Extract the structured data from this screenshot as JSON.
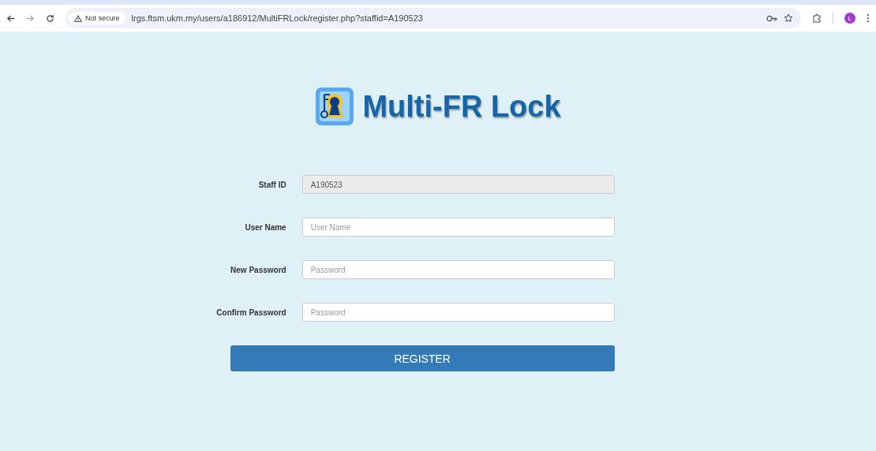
{
  "browser": {
    "security_label": "Not secure",
    "url": "lrgs.ftsm.ukm.my/users/a186912/MultiFRLock/register.php?staffid=A190523",
    "profile_initial": "L"
  },
  "logo": {
    "title": "Multi-FR Lock"
  },
  "form": {
    "fields": [
      {
        "label": "Staff ID",
        "value": "A190523",
        "disabled": true
      },
      {
        "label": "User Name",
        "placeholder": "User Name",
        "disabled": false
      },
      {
        "label": "New Password",
        "placeholder": "Password",
        "disabled": false
      },
      {
        "label": "Confirm Password",
        "placeholder": "Password",
        "disabled": false
      }
    ],
    "submit": "REGISTER"
  }
}
